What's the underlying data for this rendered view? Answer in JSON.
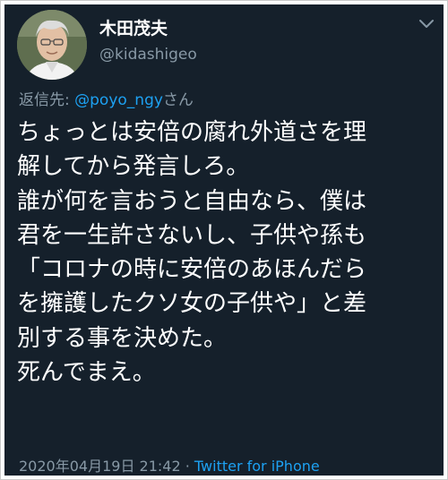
{
  "user": {
    "display_name": "木田茂夫",
    "handle": "@kidashigeo"
  },
  "reply": {
    "prefix": "返信先: ",
    "mention": "@poyo_ngy",
    "suffix": "さん"
  },
  "tweet": {
    "lines": [
      "ちょっとは安倍の腐れ外道さを理",
      "解してから発言しろ。",
      "誰が何を言おうと自由なら、僕は",
      "君を一生許さないし、子供や孫も",
      "「コロナの時に安倍のあほんだら",
      "を擁護したクソ女の子供や」と差",
      "別する事を決めた。",
      "死んでまえ。"
    ]
  },
  "meta": {
    "timestamp": "2020年04月19日 21:42",
    "separator": " · ",
    "source": "Twitter for iPhone"
  },
  "colors": {
    "background": "#15202b",
    "text": "#ffffff",
    "secondary": "#8899a6",
    "accent": "#1da1f2"
  },
  "icons": {
    "menu": "chevron-down-icon"
  }
}
